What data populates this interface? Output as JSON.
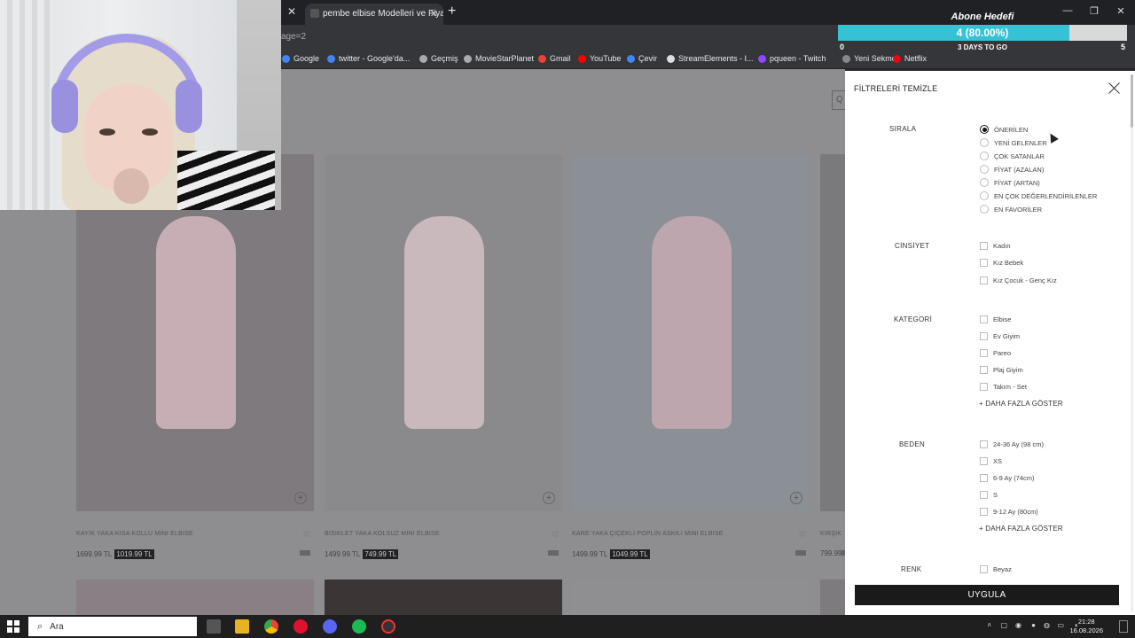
{
  "browser": {
    "tab_title": "pembe elbise Modelleri ve Fiya",
    "url_fragment": "age=2",
    "bookmarks": [
      {
        "label": "Google",
        "icon": "google-icon",
        "color": "#4285f4"
      },
      {
        "label": "twitter - Google'da...",
        "icon": "google-icon",
        "color": "#4285f4"
      },
      {
        "label": "Geçmiş",
        "icon": "history-icon",
        "color": "#aaaaaa"
      },
      {
        "label": "MovieStarPlanet",
        "icon": "star-icon",
        "color": "#aaaaaa"
      },
      {
        "label": "Gmail",
        "icon": "gmail-icon",
        "color": "#ea4335"
      },
      {
        "label": "YouTube",
        "icon": "youtube-icon",
        "color": "#ff0000"
      },
      {
        "label": "Çevir",
        "icon": "translate-icon",
        "color": "#4285f4"
      },
      {
        "label": "StreamElements - I...",
        "icon": "streamelements-icon",
        "color": "#dddddd"
      },
      {
        "label": "pqueen - Twitch",
        "icon": "twitch-icon",
        "color": "#9146ff"
      },
      {
        "label": "Yeni Sekme",
        "icon": "page-icon",
        "color": "#888888"
      },
      {
        "label": "Netflix",
        "icon": "netflix-icon",
        "color": "#e50914"
      }
    ]
  },
  "goal": {
    "title": "Abone Hedefi",
    "progress_text": "4 (80.00%)",
    "progress_fraction": 0.8,
    "min": "0",
    "days": "3 DAYS TO GO",
    "max": "5"
  },
  "products": [
    {
      "name": "KAYIK YAKA KISA KOLLU MİNİ ELBİSE",
      "old_price": "1699.99 TL",
      "new_price": "1019.99 TL",
      "img_color": "#7e7a7e",
      "dress_color": "#c7aeb4"
    },
    {
      "name": "BİSİKLET YAKA KOLSUZ MİNİ ELBİSE",
      "old_price": "1499.99 TL",
      "new_price": "749.99 TL",
      "img_color": "#8a8a8c",
      "dress_color": "#c9b9bd"
    },
    {
      "name": "KARE YAKA ÇİÇEKLİ POPLİN ASKILI MİNİ ELBİSE",
      "old_price": "1499.99 TL",
      "new_price": "1049.99 TL",
      "img_color": "#8b8f96",
      "dress_color": "#bda6ad"
    },
    {
      "name": "KIRŞIK",
      "old_price": "799.99",
      "new_price": "",
      "img_color": "#7a7a7c",
      "dress_color": "#999"
    }
  ],
  "filter": {
    "clear_label": "FİLTRELERİ TEMİZLE",
    "apply_label": "UYGULA",
    "sort": {
      "label": "SIRALA",
      "options": [
        "ÖNERİLEN",
        "YENİ GELENLER",
        "ÇOK SATANLAR",
        "FİYAT (AZALAN)",
        "FİYAT (ARTAN)",
        "EN ÇOK DEĞERLENDİRİLENLER",
        "EN FAVORİLER"
      ],
      "selected_index": 0
    },
    "gender": {
      "label": "CİNSİYET",
      "options": [
        "Kadın",
        "Kız Bebek",
        "Kız Çocuk - Genç Kız"
      ]
    },
    "category": {
      "label": "KATEGORİ",
      "options": [
        "Elbise",
        "Ev Giyim",
        "Pareo",
        "Plaj Giyim",
        "Takım - Set"
      ],
      "more_label": "+ DAHA FAZLA GÖSTER"
    },
    "size": {
      "label": "BEDEN",
      "options": [
        "24-36 Ay (98 cm)",
        "XS",
        "6-9 Ay (74cm)",
        "S",
        "9-12 Ay (80cm)"
      ],
      "more_label": "+ DAHA FAZLA GÖSTER"
    },
    "color": {
      "label": "RENK",
      "options": [
        "Beyaz"
      ]
    }
  },
  "taskbar": {
    "search_placeholder": "Ara",
    "time": "21:28",
    "date": "16.08.2026"
  }
}
